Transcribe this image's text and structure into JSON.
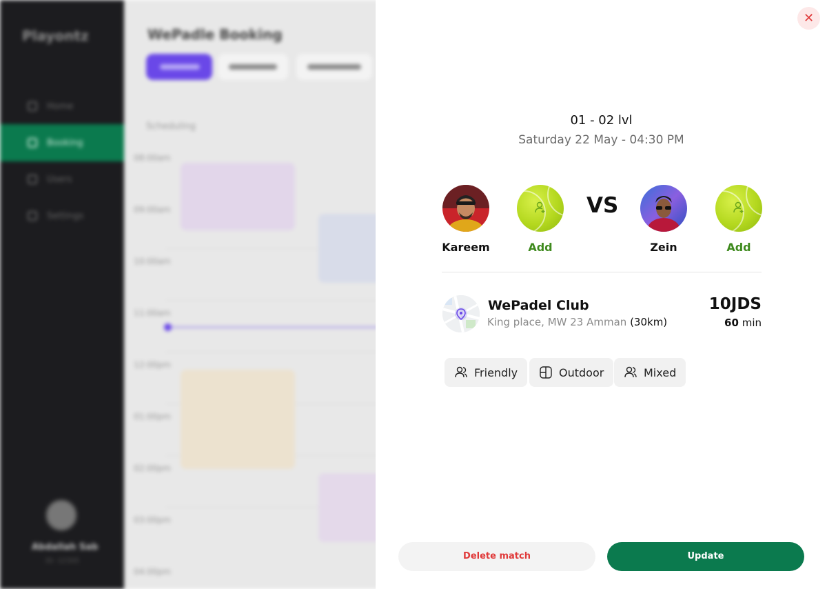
{
  "background": {
    "app_name": "Playontz",
    "page_title": "WePadle Booking",
    "nav": [
      "Home",
      "Booking",
      "Users",
      "Settings"
    ],
    "toolbar_label": "Scheduling",
    "user_name": "Abdallah Sab",
    "user_sub": "ID: 12345",
    "times": [
      "08:00am",
      "09:00am",
      "10:00am",
      "11:00am",
      "12:00pm",
      "01:00pm",
      "02:00pm",
      "03:00pm",
      "04:00pm"
    ]
  },
  "match": {
    "level": "01 - 02 lvl",
    "datetime": "Saturday 22 May - 04:30 PM",
    "vs_label": "VS",
    "players": [
      {
        "name": "Kareem"
      },
      {
        "name": "Add"
      },
      {
        "name": "Zein"
      },
      {
        "name": "Add"
      }
    ]
  },
  "club": {
    "name": "WePadel Club",
    "address": "King place, MW 23 Amman",
    "distance": "(30km)",
    "price": "10JDS",
    "duration_value": "60",
    "duration_unit": "min"
  },
  "tags": [
    "Friendly",
    "Outdoor",
    "Mixed"
  ],
  "actions": {
    "delete_label": "Delete match",
    "update_label": "Update"
  },
  "colors": {
    "primary_green": "#0b7a4e",
    "add_green": "#3f8a1e",
    "danger_red": "#e03a3a",
    "accent_purple": "#6a48e8"
  }
}
